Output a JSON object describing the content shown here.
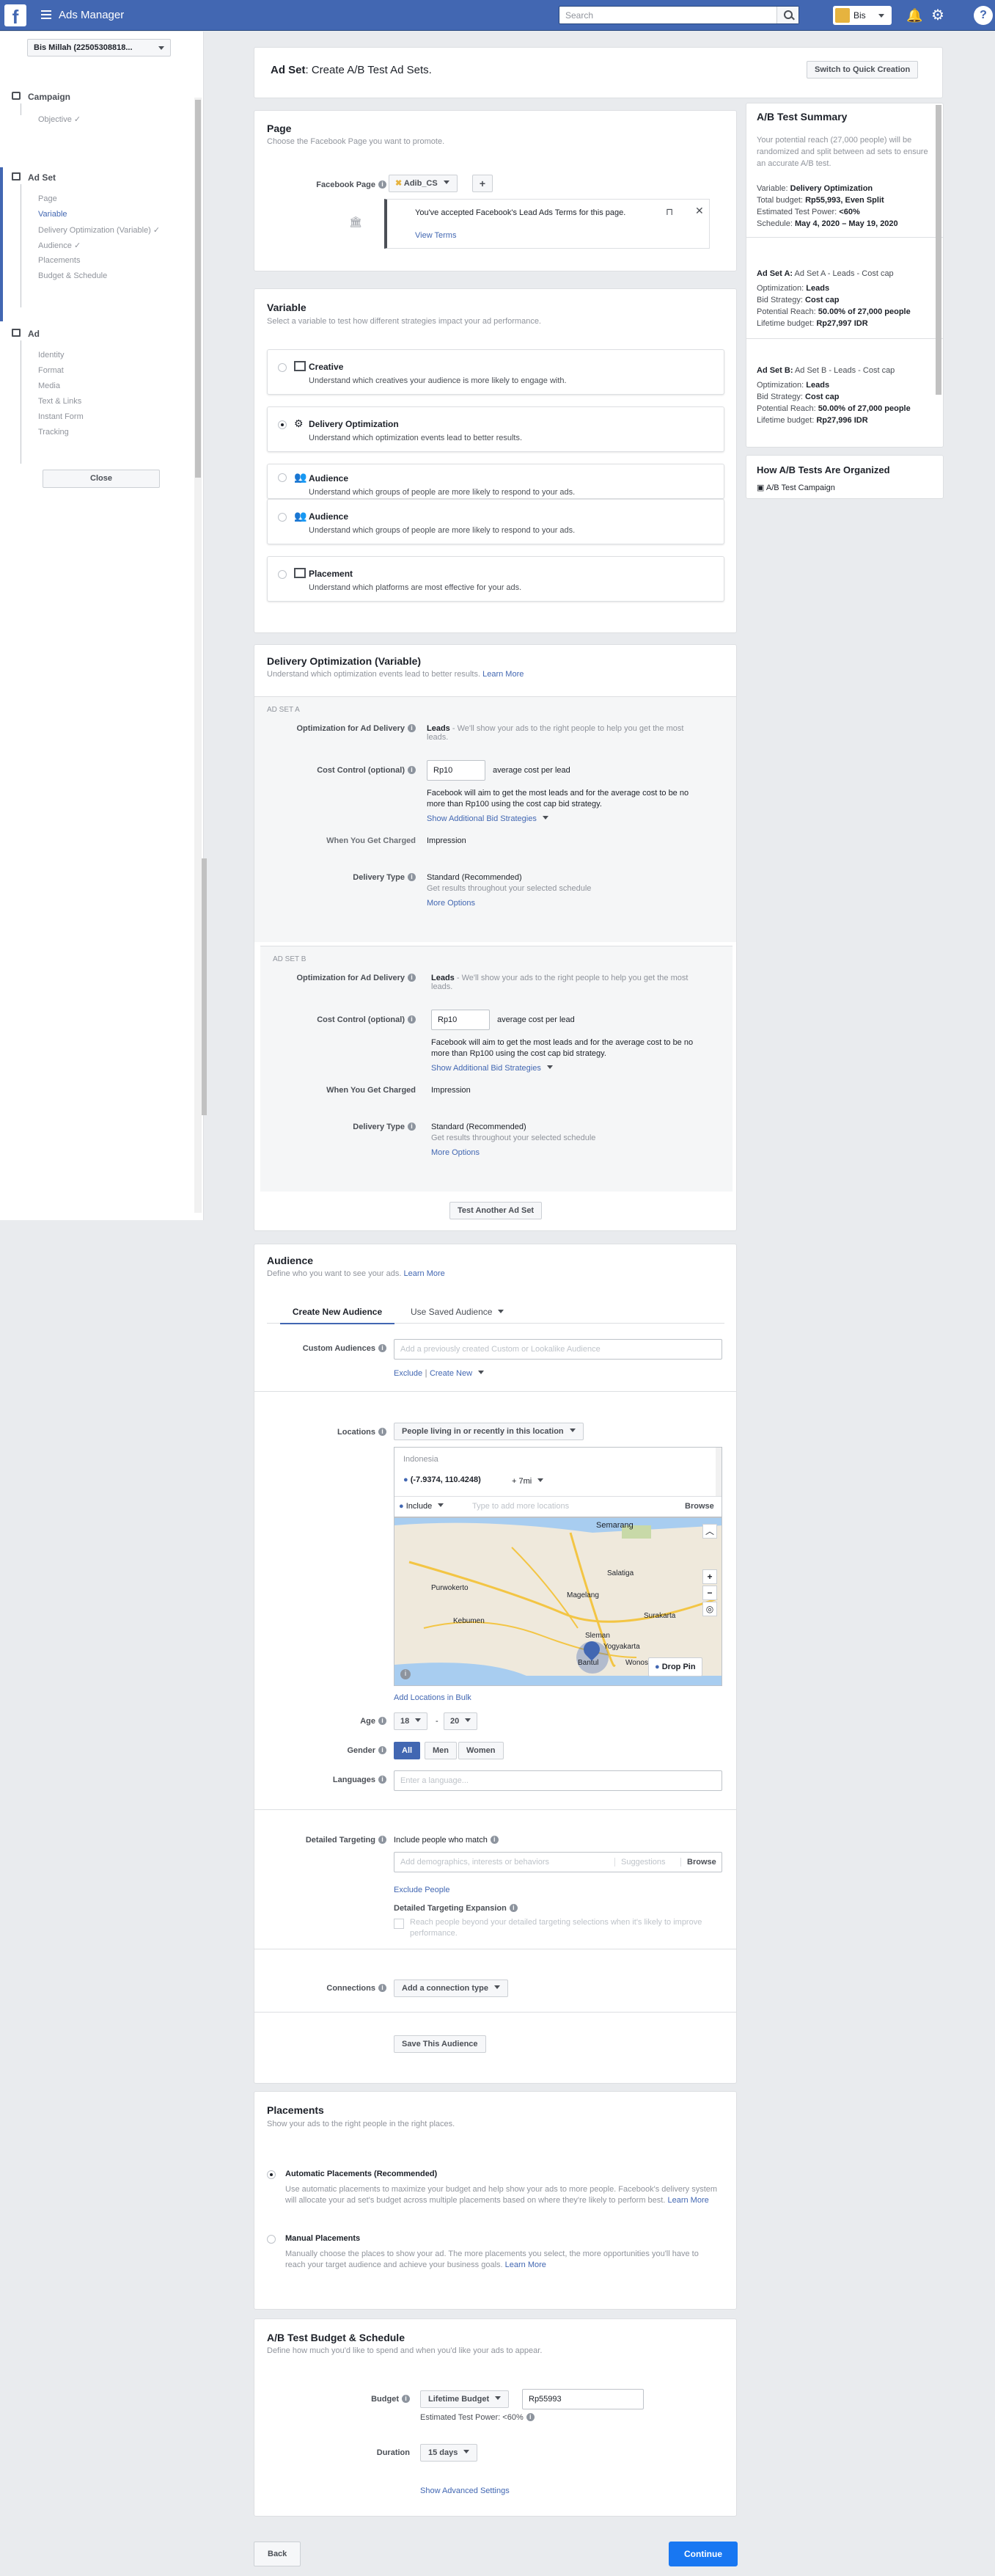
{
  "topbar": {
    "logo": "f",
    "title": "Ads Manager",
    "search_placeholder": "Search",
    "account_name": "Bis"
  },
  "sidebar": {
    "campaign_select": "Bis Millah (22505308818...",
    "campaign_header": "Campaign",
    "campaign_items": [
      "Objective"
    ],
    "adset_header": "Ad Set",
    "adset_items": [
      "Page",
      "Variable",
      "Delivery Optimization (Variable)",
      "Audience",
      "Placements",
      "Budget & Schedule"
    ],
    "ad_header": "Ad",
    "ad_items": [
      "Identity",
      "Format",
      "Media",
      "Text & Links",
      "Instant Form",
      "Tracking"
    ],
    "close": "Close"
  },
  "header": {
    "prefix": "Ad Set",
    "title": ": Create A/B Test Ad Sets.",
    "quick_button": "Switch to Quick Creation"
  },
  "page": {
    "title": "Page",
    "subtitle": "Choose the Facebook Page you want to promote.",
    "label": "Facebook Page",
    "page_name": "Adib_CS",
    "plus": "+",
    "notice": "You've accepted Facebook's Lead Ads Terms for this page.",
    "view_terms": "View Terms"
  },
  "variable": {
    "title": "Variable",
    "subtitle": "Select a variable to test how different strategies impact your ad performance.",
    "options": [
      {
        "title": "Creative",
        "desc": "Understand which creatives your audience is more likely to engage with."
      },
      {
        "title": "Delivery Optimization",
        "desc": "Understand which optimization events lead to better results."
      },
      {
        "title": "Audience",
        "desc": "Understand which groups of people are more likely to respond to your ads."
      },
      {
        "title": "Audience",
        "desc": "Understand which groups of people are more likely to respond to your ads."
      },
      {
        "title": "Placement",
        "desc": "Understand which platforms are most effective for your ads."
      }
    ]
  },
  "delivery": {
    "title": "Delivery Optimization (Variable)",
    "subtitle": "Understand which optimization events lead to better results.",
    "learn_more": "Learn More",
    "adset_a": "AD SET A",
    "adset_b": "AD SET B",
    "opt_label": "Optimization for Ad Delivery",
    "opt_value": "Leads",
    "opt_desc": " - We'll show your ads to the right people to help you get the most leads.",
    "cost_label": "Cost Control (optional)",
    "cost_value": "Rp10",
    "cost_unit": "average cost per lead",
    "cost_note": "Facebook will aim to get the most leads and for the average cost to be no more than Rp100 using the cost cap bid strategy.",
    "show_bid": "Show Additional Bid Strategies",
    "charged_label": "When You Get Charged",
    "charged_value": "Impression",
    "type_label": "Delivery Type",
    "type_value": "Standard (Recommended)",
    "type_desc": "Get results throughout your selected schedule",
    "more_options": "More Options",
    "test_another": "Test Another Ad Set"
  },
  "audience": {
    "title": "Audience",
    "subtitle": "Define who you want to see your ads.",
    "learn_more": "Learn More",
    "tab_new": "Create New Audience",
    "tab_saved": "Use Saved Audience",
    "custom_label": "Custom Audiences",
    "custom_placeholder": "Add a previously created Custom or Lookalike Audience",
    "exclude": "Exclude",
    "create_new": "Create New",
    "locations_label": "Locations",
    "locations_select": "People living in or recently in this location",
    "country": "Indonesia",
    "pin": "(-7.9374, 110.4248)",
    "radius": "+ 7mi",
    "include": "Include",
    "loc_placeholder": "Type to add more locations",
    "browse": "Browse",
    "map_labels": [
      "Semarang",
      "Salatiga",
      "Purwokerto",
      "Magelang",
      "Surakarta",
      "Kebumen",
      "Sleman",
      "Yogyakarta",
      "Bantul",
      "Wonosari"
    ],
    "drop_pin": "Drop Pin",
    "add_bulk": "Add Locations in Bulk",
    "age_label": "Age",
    "age_min": "18",
    "age_max": "20",
    "gender_label": "Gender",
    "genders": [
      "All",
      "Men",
      "Women"
    ],
    "languages_label": "Languages",
    "languages_placeholder": "Enter a language...",
    "detailed_label": "Detailed Targeting",
    "include_match": "Include people who match",
    "detailed_placeholder": "Add demographics, interests or behaviors",
    "suggestions": "Suggestions",
    "exclude_people": "Exclude People",
    "expansion_label": "Detailed Targeting Expansion",
    "expansion_text": "Reach people beyond your detailed targeting selections when it's likely to improve performance.",
    "connections_label": "Connections",
    "connections_select": "Add a connection type",
    "save": "Save This Audience"
  },
  "placements": {
    "title": "Placements",
    "subtitle": "Show your ads to the right people in the right places.",
    "auto_title": "Automatic Placements (Recommended)",
    "auto_desc": "Use automatic placements to maximize your budget and help show your ads to more people. Facebook's delivery system will allocate your ad set's budget across multiple placements based on where they're likely to perform best.",
    "manual_title": "Manual Placements",
    "manual_desc": "Manually choose the places to show your ad. The more placements you select, the more opportunities you'll have to reach your target audience and achieve your business goals.",
    "learn_more": "Learn More"
  },
  "budget": {
    "title": "A/B Test Budget & Schedule",
    "subtitle": "Define how much you'd like to spend and when you'd like your ads to appear.",
    "budget_label": "Budget",
    "budget_type": "Lifetime Budget",
    "budget_value": "Rp55993",
    "power": "Estimated Test Power: <60%",
    "duration_label": "Duration",
    "duration_value": "15 days",
    "advanced": "Show Advanced Settings"
  },
  "footer": {
    "back": "Back",
    "continue": "Continue"
  },
  "summary": {
    "title": "A/B Test Summary",
    "intro": "Your potential reach (27,000 people) will be randomized and split between ad sets to ensure an accurate A/B test.",
    "variable_k": "Variable:",
    "variable_v": "Delivery Optimization",
    "budget_k": "Total budget:",
    "budget_v": "Rp55,993, Even Split",
    "power_k": "Estimated Test Power:",
    "power_v": "<60%",
    "schedule_k": "Schedule:",
    "schedule_v": "May 4, 2020 – May 19, 2020",
    "a_title": "Ad Set A:",
    "a_name": "Ad Set A - Leads - Cost cap",
    "b_title": "Ad Set B:",
    "b_name": "Ad Set B - Leads - Cost cap",
    "opt_k": "Optimization:",
    "opt_v": "Leads",
    "bid_k": "Bid Strategy:",
    "bid_v": "Cost cap",
    "reach_k": "Potential Reach:",
    "reach_v": "50.00% of 27,000 people",
    "life_k": "Lifetime budget:",
    "life_v": "Rp27,997 IDR",
    "life_v_b": "Rp27,996 IDR",
    "howto_title": "How A/B Tests Are Organized",
    "howto_item": "A/B Test Campaign"
  }
}
